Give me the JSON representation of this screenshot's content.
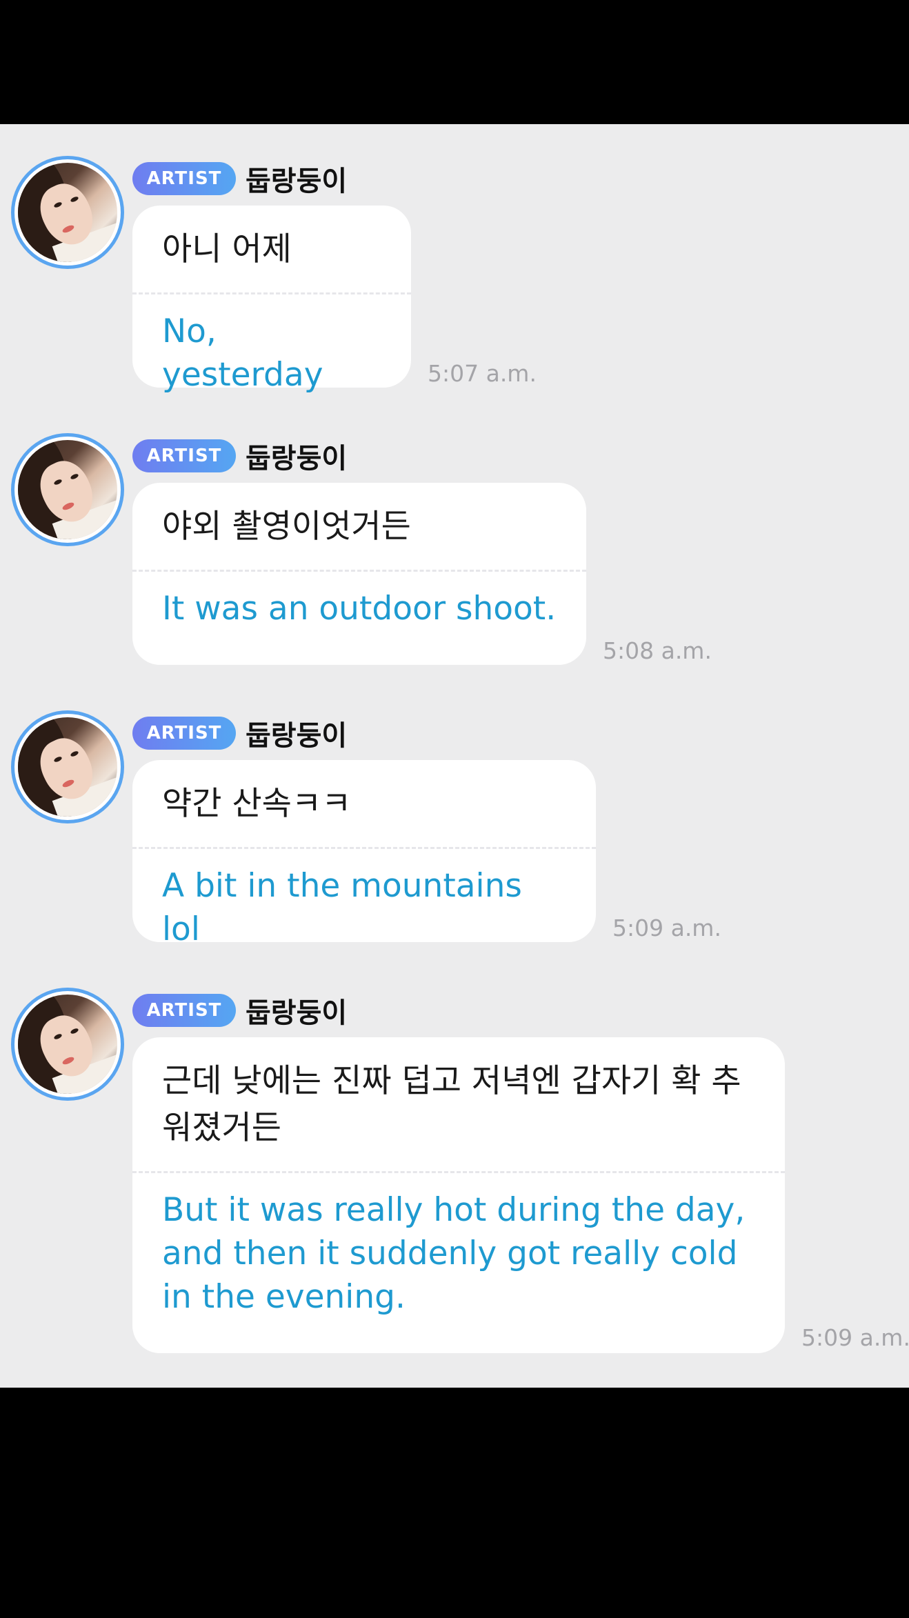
{
  "messages": [
    {
      "badge": "ARTIST",
      "name": "둡랑둥이",
      "original": "아니 어제",
      "translation": "No, yesterday",
      "time": "5:07 a.m."
    },
    {
      "badge": "ARTIST",
      "name": "둡랑둥이",
      "original": "야외 촬영이엇거든",
      "translation": "It was an outdoor shoot.",
      "time": "5:08 a.m."
    },
    {
      "badge": "ARTIST",
      "name": "둡랑둥이",
      "original": "약간 산속ㅋㅋ",
      "translation": "A bit in the mountains lol",
      "time": "5:09 a.m."
    },
    {
      "badge": "ARTIST",
      "name": "둡랑둥이",
      "original": "근데 낮에는 진짜 덥고 저녁엔 갑자기 확 추워졌거든",
      "translation": "But it was really hot during the day, and then it suddenly got really cold in the evening.",
      "time": "5:09 a.m."
    }
  ],
  "colors": {
    "background": "#000000",
    "chat_background": "#ececed",
    "bubble": "#ffffff",
    "translation_text": "#1e9ad0",
    "badge_gradient_start": "#6f7df0",
    "badge_gradient_end": "#55a6f2",
    "avatar_ring": "#5aa5f0",
    "timestamp": "#a4a4a8"
  },
  "icons": {
    "avatar": "profile-photo"
  }
}
